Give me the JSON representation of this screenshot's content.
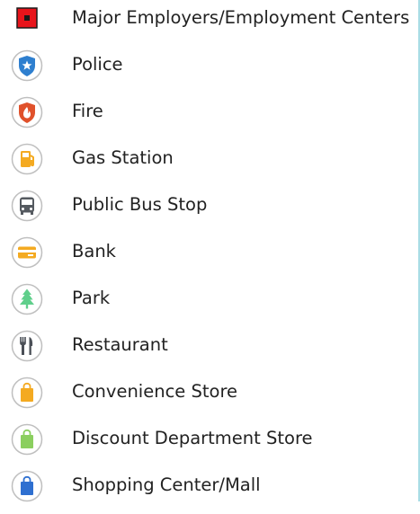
{
  "legend": {
    "items": [
      {
        "label": "Major Employers/Employment Centers",
        "icon": "employer-square-icon",
        "color": "#e8141b"
      },
      {
        "label": "Police",
        "icon": "police-star-icon",
        "color": "#2e7fcf"
      },
      {
        "label": "Fire",
        "icon": "fire-shield-icon",
        "color": "#e0512b"
      },
      {
        "label": "Gas Station",
        "icon": "gas-pump-icon",
        "color": "#f4aa21"
      },
      {
        "label": "Public Bus Stop",
        "icon": "bus-icon",
        "color": "#555a60"
      },
      {
        "label": "Bank",
        "icon": "bank-card-icon",
        "color": "#f4aa21"
      },
      {
        "label": "Park",
        "icon": "tree-icon",
        "color": "#5fcf8b"
      },
      {
        "label": "Restaurant",
        "icon": "fork-knife-icon",
        "color": "#4a4f56"
      },
      {
        "label": "Convenience Store",
        "icon": "shopping-bag-icon",
        "color": "#f4aa21"
      },
      {
        "label": "Discount Department Store",
        "icon": "shopping-bag-icon",
        "color": "#8bcf5f"
      },
      {
        "label": "Shopping Center/Mall",
        "icon": "shopping-bag-icon",
        "color": "#2e6fd0"
      }
    ]
  }
}
